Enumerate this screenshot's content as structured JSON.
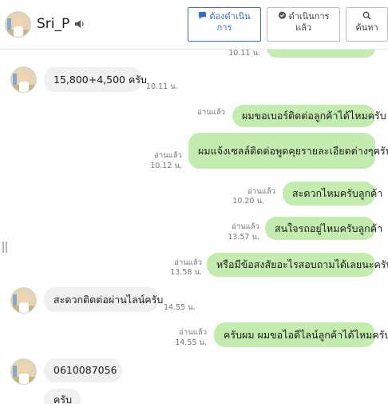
{
  "header": {
    "contact_name": "Sri_P",
    "buttons": {
      "in_progress_line1": "ต้องดำเนิน",
      "in_progress_line2": "การ",
      "done_line1": "ดำเนินการ",
      "done_line2": "แล้ว",
      "search": "ค้นหา"
    }
  },
  "messages": {
    "m0": {
      "time": "10.11 น."
    },
    "m1": {
      "text": "15,800+4,500 ครับ",
      "time": "10.11 น."
    },
    "m2": {
      "text": "ผมขอเบอร์ติดต่อลูกค้าได้ไหมครับ",
      "read": "อ่านแล้ว"
    },
    "m3": {
      "text": "ผมแจ้งเซลล์ติดต่อพูดคุยรายละเอียดต่างๆครับ",
      "read": "อ่านแล้ว",
      "time": "10.12 น."
    },
    "m4": {
      "text": "สะดวกไหมครับลูกค้า",
      "read": "อ่านแล้ว",
      "time": "10.20 น."
    },
    "m5": {
      "text": "สนใจรถอยู่ไหมครับลูกค้า",
      "read": "อ่านแล้ว",
      "time": "13.57 น."
    },
    "m6": {
      "text": "หรือมีข้อสงสัยอะไรสอบถามได้เลยนะครับ",
      "read": "อ่านแล้ว",
      "time": "13.58 น."
    },
    "m7": {
      "text": "สะดวกติดต่อผ่านไลน์ครับ",
      "time": "14.55 น."
    },
    "m8": {
      "text": "ครับผม ผมขอไอดีไลน์ลูกค้าได้ไหมครับ",
      "read": "อ่านแล้ว",
      "time": "14.55 น."
    },
    "m9": {
      "text": "0610087056"
    },
    "m10": {
      "text": "ครับ"
    }
  },
  "colors": {
    "outgoing_bubble": "#c4ecb0",
    "incoming_bubble": "#f0f0f0",
    "accent": "#3f6bc4"
  },
  "icons": [
    "avatar",
    "speaker-icon",
    "chat-bubble-icon",
    "chat-check-icon",
    "search-icon",
    "resize-handle-icon"
  ]
}
